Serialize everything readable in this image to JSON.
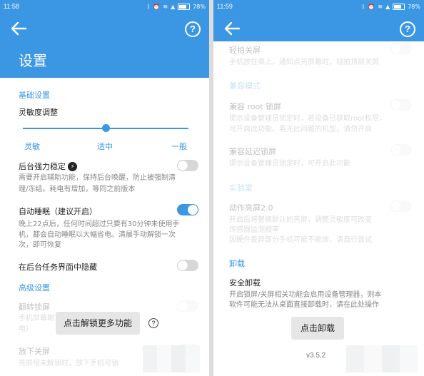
{
  "left": {
    "status": {
      "time": "11:58",
      "battery": "78%",
      "battery_level": 0.78
    },
    "title": "设置",
    "section_basic": "基础设置",
    "sensitivity": {
      "label": "灵敏度调整",
      "options": [
        "灵敏",
        "适中",
        "一般"
      ],
      "value": 0.5
    },
    "keepalive": {
      "label": "后台强力稳定",
      "desc1": "需要开启辅助功能，保持后台唤醒，防止被强制清",
      "desc2": "理/冻结。耗电有增加，等同之前版本",
      "on": false
    },
    "autosleep": {
      "label": "自动睡眠（建议开启）",
      "desc1": "晚上22点后，任何时间超过只要有30分钟未使用手",
      "desc2": "机，都会自动睡眠以大幅省电。清晨手动解锁一次",
      "desc3": "次，即可恢复",
      "on": true
    },
    "hide_recent": {
      "label": "在后台任务界面中隐藏",
      "on": false
    },
    "section_advanced": "高级设置",
    "flip_lock": {
      "label": "翻转锁屏",
      "desc1": "手机屏幕朝下时锁屏",
      "desc2": "电）"
    },
    "unlock_more": "点击解锁更多功能",
    "help_mark": "?",
    "putdown": {
      "label": "放下关屏",
      "desc": "亮屏但未解锁时，放下手机可锁"
    }
  },
  "right": {
    "status": {
      "time": "11:59",
      "battery": "78%",
      "battery_level": 0.78
    },
    "tap_off": {
      "label": "轻拍关屏",
      "desc": "手机放在桌上，通知点亮屏幕时，轻拍顶部关屏"
    },
    "section_compat": "兼容模式",
    "root_lock": {
      "label": "兼容 root 锁屏",
      "desc1": "提示设备管理员锁定时，若设备已获取root权限，",
      "desc2": "可开启此功能。若无此问题的机型，请勿开启"
    },
    "delay_lock": {
      "label": "兼容延迟锁屏",
      "desc": "提示设备管理员锁定时，可开启此功能"
    },
    "section_lab": "实验室",
    "motion": {
      "label": "动作亮屏2.0",
      "desc1": "开启后将替换默认的亮屏，调整灵敏度可改变",
      "desc2": "传感器监测频率",
      "desc3": "因硬件差异部分手机可能不能效，请自行尝试"
    },
    "section_uninstall": "卸载",
    "safe_uninstall": {
      "label": "安全卸载",
      "desc1": "开启锁屏/关屏相关功能会启用设备管理器，则本",
      "desc2": "软件可能无法从桌面直接卸载时，请在此处操作"
    },
    "uninstall_button": "点击卸载",
    "version": "v3.5.2"
  },
  "help_icon_label": "?",
  "colors": {
    "accent": "#3b97e3"
  }
}
